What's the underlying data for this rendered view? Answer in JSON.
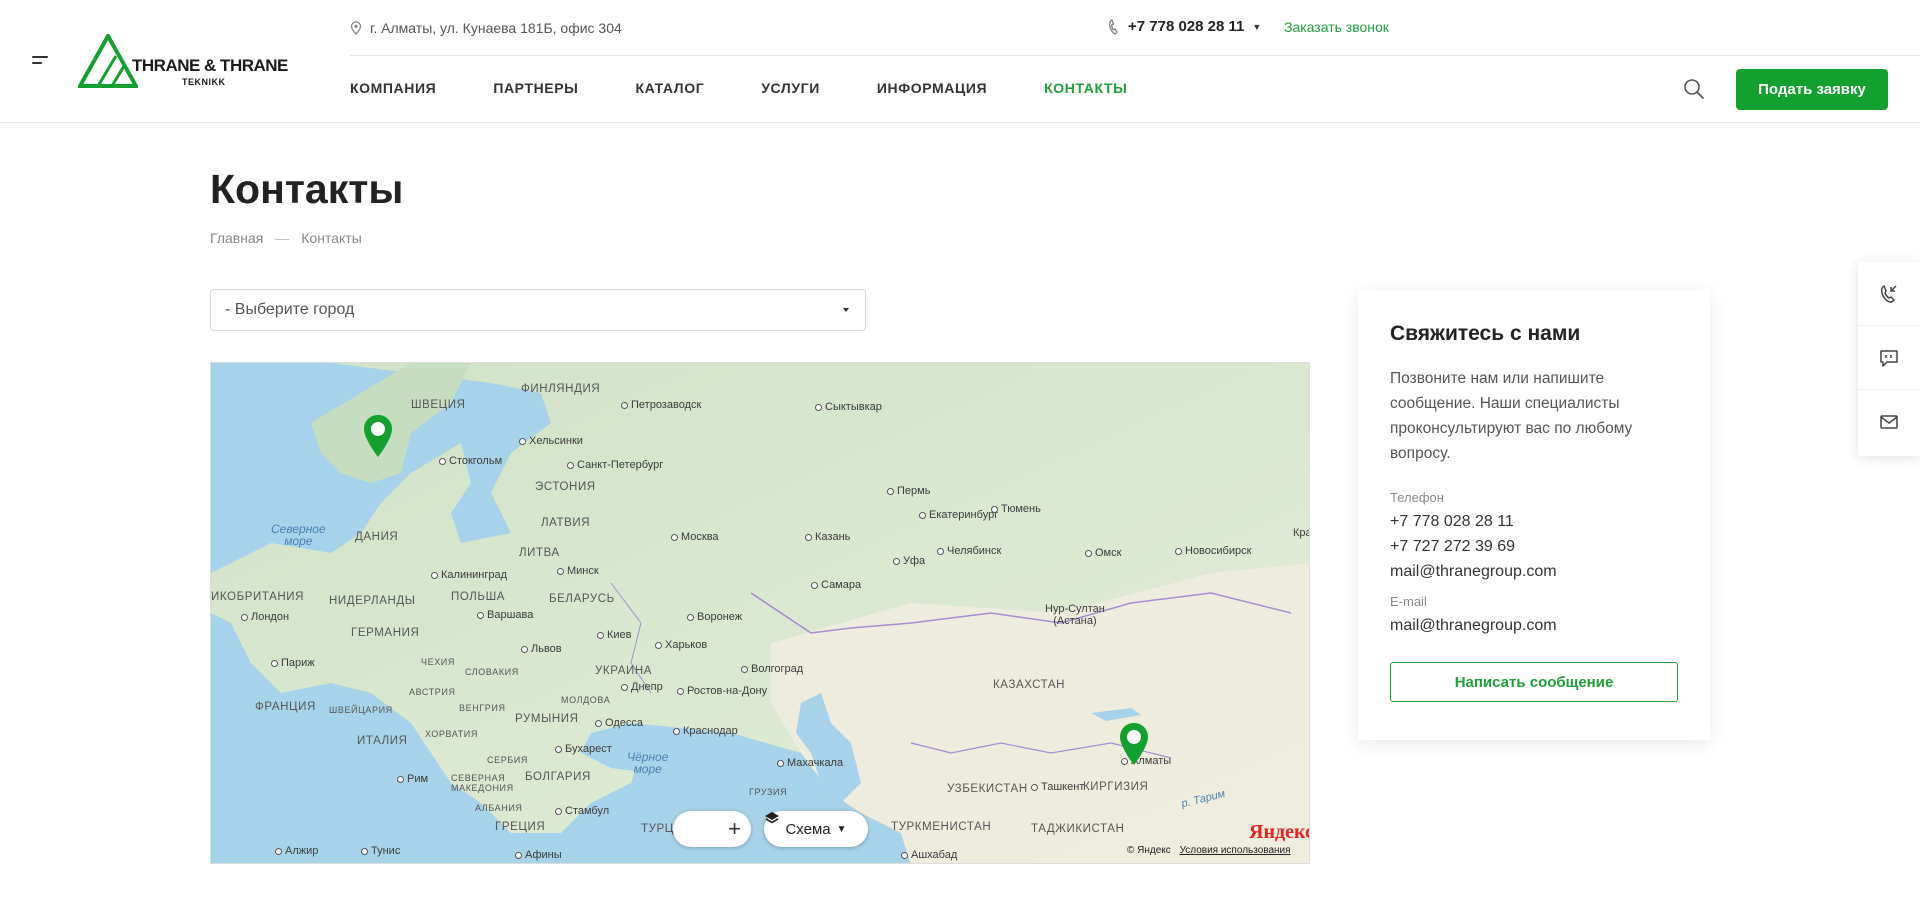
{
  "header": {
    "logo": {
      "name": "THRANE & THRANE",
      "sub": "TEKNIKK"
    },
    "address": "г. Алматы, ул. Кунаева 181Б, офис 304",
    "phone": "+7 778 028 28 11",
    "callback_label": "Заказать звонок",
    "nav": [
      {
        "label": "КОМПАНИЯ",
        "active": false
      },
      {
        "label": "ПАРТНЕРЫ",
        "active": false
      },
      {
        "label": "КАТАЛОГ",
        "active": false
      },
      {
        "label": "УСЛУГИ",
        "active": false
      },
      {
        "label": "ИНФОРМАЦИЯ",
        "active": false
      },
      {
        "label": "КОНТАКТЫ",
        "active": true
      }
    ],
    "cta_label": "Подать заявку",
    "accent": "#12a02f"
  },
  "page": {
    "title": "Контакты",
    "breadcrumbs": [
      "Главная",
      "—",
      "Контакты"
    ],
    "city_select": {
      "value": "- Выберите город"
    }
  },
  "map": {
    "labels": {
      "sweden": "ШВЕЦИЯ",
      "finland": "ФИНЛЯНДИЯ",
      "petrozavodsk": "Петрозаводск",
      "syktyvkar": "Сыктывкар",
      "helsinki": "Хельсинки",
      "stockholm": "Стокгольм",
      "spb": "Санкт-Петербург",
      "estonia": "ЭСТОНИЯ",
      "perm": "Пермь",
      "yekaterinburg": "Екатеринбург",
      "tyumen": "Тюмень",
      "north_sea": "Северное\nморе",
      "denmark": "ДАНИЯ",
      "latvia": "ЛАТВИЯ",
      "moscow": "Москва",
      "kazan": "Казань",
      "lithuania": "ЛИТВА",
      "chelyabinsk": "Челябинск",
      "omsk": "Омск",
      "novosibirsk": "Новосибирск",
      "kra": "Кра",
      "kaliningrad": "Калининград",
      "minsk": "Минск",
      "ufa": "Уфа",
      "uk": "ИКОБРИТАНИЯ",
      "netherlands": "НИДЕРЛАНДЫ",
      "poland": "ПОЛЬША",
      "belarus": "БЕЛАРУСЬ",
      "samara": "Самара",
      "london": "Лондон",
      "warsaw": "Варшава",
      "voronezh": "Воронеж",
      "nursultan": "Нур-Султан\n(Астана)",
      "germany": "ГЕРМАНИЯ",
      "lviv": "Львов",
      "kyiv": "Киев",
      "kharkiv": "Харьков",
      "paris": "Париж",
      "czech": "ЧЕХИЯ",
      "slovakia": "СЛОВАКИЯ",
      "ukraine": "УКРАИНА",
      "volgograd": "Волгоград",
      "dnipro": "Днепр",
      "rostov": "Ростов-на-Дону",
      "kazakhstan": "КАЗАХСТАН",
      "france": "ФРАНЦИЯ",
      "austria": "АВСТРИЯ",
      "moldova": "МОЛДОВА",
      "switzerland": "ШВЕЙЦАРИЯ",
      "hungary": "ВЕНГРИЯ",
      "romania": "РУМЫНИЯ",
      "odesa": "Одесса",
      "krasnodar": "Краснодар",
      "italy": "ИТАЛИЯ",
      "croatia": "ХОРВАТИЯ",
      "bucharest": "Бухарест",
      "black_sea": "Чёрное\nморе",
      "makhachkala": "Махачкала",
      "rome": "Рим",
      "serbia": "СЕРБИЯ",
      "bulgaria": "БОЛГАРИЯ",
      "georgia": "ГРУЗИЯ",
      "n_macedonia": "СЕВЕРНАЯ\nМАКЕДОНИЯ",
      "uzbekistan": "УЗБЕКИСТАН",
      "tashkent": "Ташкент",
      "kyrgyzstan": "КИРГИЗИЯ",
      "almaty": "Алматы",
      "albania": "АЛБАНИЯ",
      "greece": "ГРЕЦИЯ",
      "istanbul": "Стамбул",
      "turkey": "ТУРЦ",
      "turkmenistan": "ТУРКМЕНИСТАН",
      "tajikistan": "ТАДЖИКИСТАН",
      "tarim": "р. Тарим",
      "algiers": "Алжир",
      "tunis": "Тунис",
      "athens": "Афины",
      "ashgabat": "Ашхабад"
    },
    "layer_label": "Схема",
    "zoom_plus": "+",
    "provider_logo": "Яндекс",
    "copyright": "© Яндекс",
    "terms": "Условия использования"
  },
  "contact_card": {
    "title": "Свяжитесь с нами",
    "description": "Позвоните нам или напишите сообщение. Наши специалисты проконсультируют вас по любому вопросу.",
    "phone_label": "Телефон",
    "phones": [
      "+7 778 028 28 11",
      "+7 727 272 39 69",
      "mail@thranegroup.com"
    ],
    "email_label": "E-mail",
    "email": "mail@thranegroup.com",
    "button_label": "Написать сообщение"
  }
}
